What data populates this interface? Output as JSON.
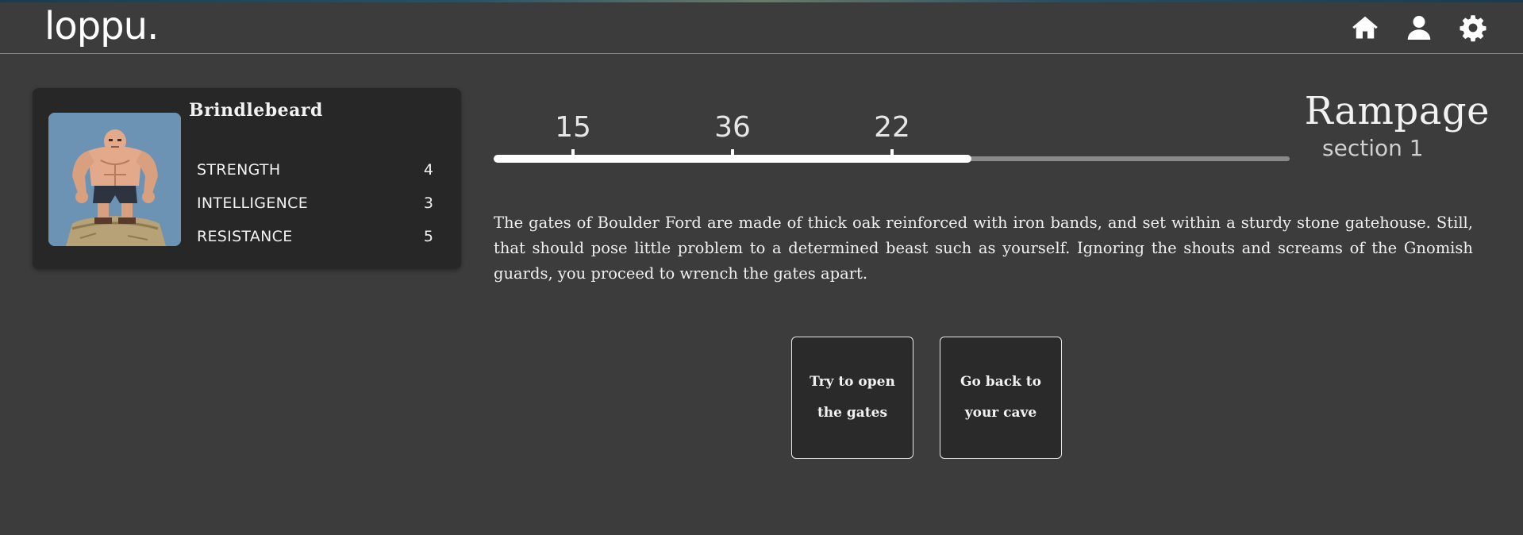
{
  "app": {
    "logo": "loppu."
  },
  "nav": {
    "home_icon": "home-icon",
    "profile_icon": "user-icon",
    "settings_icon": "gear-icon"
  },
  "character": {
    "name": "Brindlebeard",
    "portrait": "muscular-ogre-pixel-art",
    "stats": [
      {
        "label": "STRENGTH",
        "value": "4"
      },
      {
        "label": "INTELLIGENCE",
        "value": "3"
      },
      {
        "label": "RESISTANCE",
        "value": "5"
      }
    ]
  },
  "progress": {
    "fraction": 0.6,
    "markers": [
      {
        "label": "15",
        "fraction": 0.1
      },
      {
        "label": "36",
        "fraction": 0.3
      },
      {
        "label": "22",
        "fraction": 0.5
      }
    ]
  },
  "section": {
    "title": "Rampage",
    "subtitle": "section 1"
  },
  "story": {
    "text": "The gates of Boulder Ford are made of thick oak reinforced with iron bands, and set within a sturdy stone gatehouse. Still, that should pose little problem to a determined beast such as yourself. Ignoring the shouts and screams of the Gnomish guards, you proceed to wrench the gates apart."
  },
  "choices": [
    {
      "label": "Try to open the gates"
    },
    {
      "label": "Go back to your cave"
    }
  ],
  "colors": {
    "background": "#3c3c3c",
    "card": "#272727",
    "portrait_bg": "#6c93b3",
    "progress_fill": "#ffffff",
    "progress_track": "#8a8a8a"
  }
}
